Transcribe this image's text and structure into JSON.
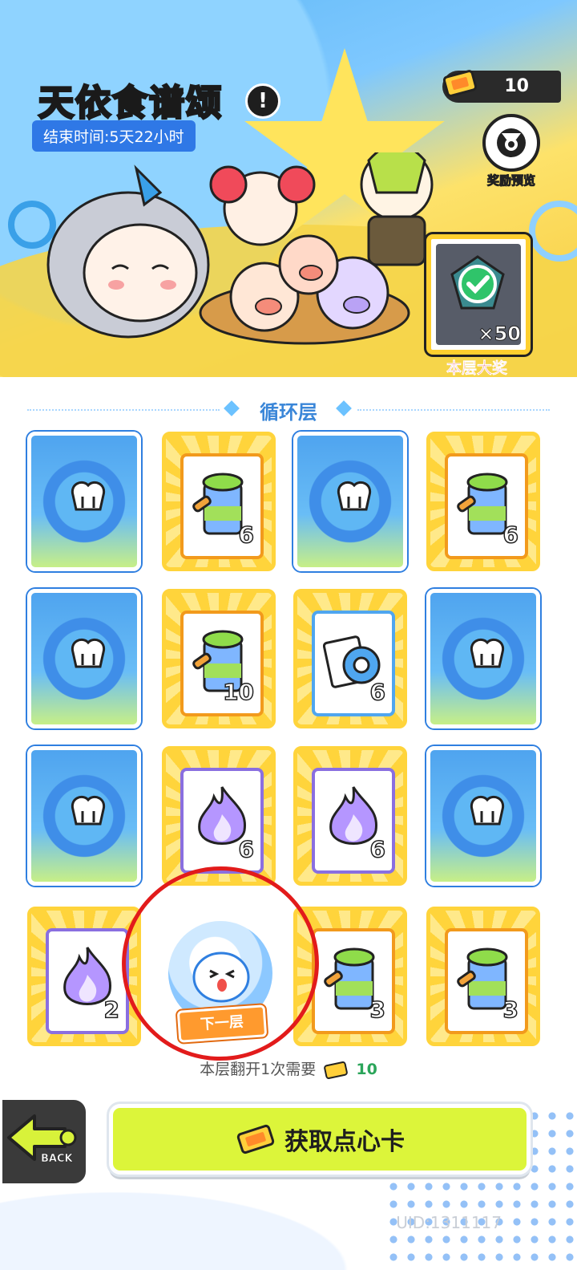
{
  "event": {
    "title": "天依食谱颂",
    "end_time": "结束时间:5天22小时",
    "info_icon": "!"
  },
  "currency": {
    "amount": "10",
    "icon": "ticket-icon"
  },
  "reward_preview": {
    "label": "奖励预览",
    "icon": "preview-icon"
  },
  "grand_prize": {
    "label": "本层大奖",
    "count": "×50",
    "icon": "gem-check-icon"
  },
  "section": {
    "title": "循环层"
  },
  "cards": [
    {
      "type": "back"
    },
    {
      "type": "item",
      "item": "drink",
      "qty": "6"
    },
    {
      "type": "back"
    },
    {
      "type": "item",
      "item": "drink",
      "qty": "6"
    },
    {
      "type": "back"
    },
    {
      "type": "item",
      "item": "drink",
      "qty": "10"
    },
    {
      "type": "item",
      "item": "tape",
      "qty": "6"
    },
    {
      "type": "back"
    },
    {
      "type": "back"
    },
    {
      "type": "item",
      "item": "flame",
      "qty": "6"
    },
    {
      "type": "item",
      "item": "flame",
      "qty": "6"
    },
    {
      "type": "back"
    },
    {
      "type": "item",
      "item": "flame",
      "qty": "2"
    },
    {
      "type": "next",
      "label": "下一层"
    },
    {
      "type": "item",
      "item": "drink",
      "qty": "3"
    },
    {
      "type": "item",
      "item": "drink",
      "qty": "3"
    }
  ],
  "cost": {
    "text": "本层翻开1次需要",
    "value": "10"
  },
  "buttons": {
    "back": "BACK",
    "get_card": "获取点心卡"
  },
  "uid": "UID:1311117",
  "colors": {
    "accent": "#dcf53a",
    "highlight_circle": "#e21b1b",
    "card_back": "#4fa4ef",
    "card_front": "#ffd43b"
  }
}
